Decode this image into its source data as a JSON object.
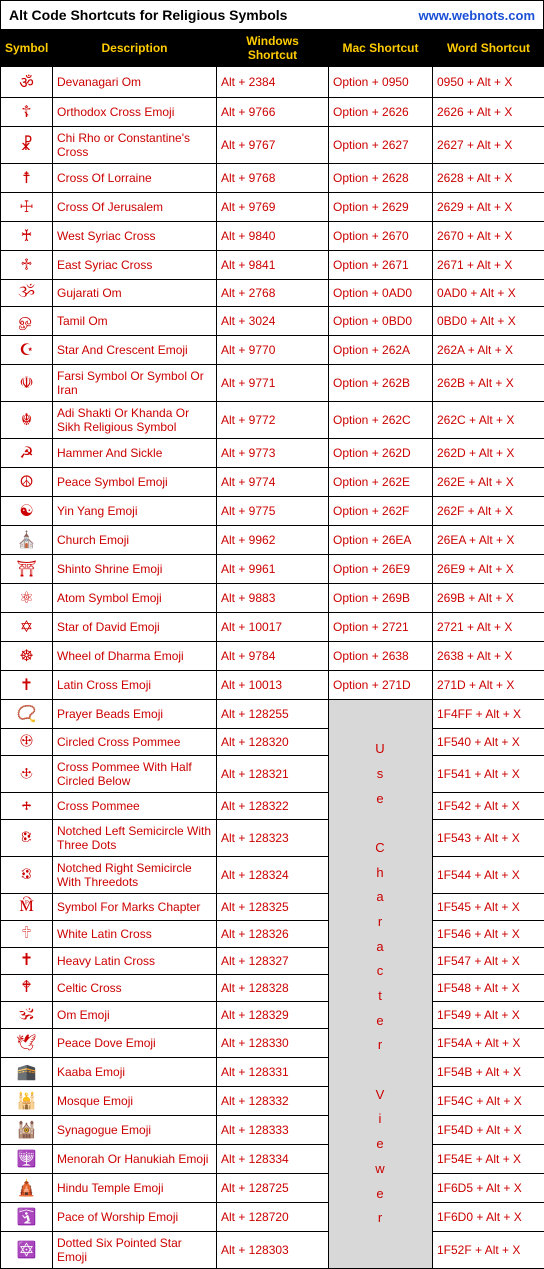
{
  "header": {
    "title": "Alt Code Shortcuts for Religious Symbols",
    "url": "www.webnots.com"
  },
  "columns": {
    "symbol": "Symbol",
    "description": "Description",
    "windows": "Windows Shortcut",
    "mac": "Mac Shortcut",
    "word": "Word Shortcut"
  },
  "mac_merged_text": "U\ns\ne\n\nC\nh\na\nr\na\nc\nt\ne\nr\n\nV\ni\ne\nw\ne\nr",
  "rows": [
    {
      "symbol": "ॐ",
      "description": "Devanagari Om",
      "windows": "Alt + 2384",
      "mac": "Option + 0950",
      "word": "0950 + Alt + X"
    },
    {
      "symbol": "☦",
      "description": "Orthodox Cross Emoji",
      "windows": "Alt + 9766",
      "mac": "Option + 2626",
      "word": "2626 + Alt + X"
    },
    {
      "symbol": "☧",
      "description": "Chi Rho or Constantine's Cross",
      "windows": "Alt + 9767",
      "mac": "Option + 2627",
      "word": "2627 + Alt + X"
    },
    {
      "symbol": "☨",
      "description": "Cross Of Lorraine",
      "windows": "Alt + 9768",
      "mac": "Option + 2628",
      "word": "2628 + Alt + X"
    },
    {
      "symbol": "☩",
      "description": "Cross Of Jerusalem",
      "windows": "Alt + 9769",
      "mac": "Option + 2629",
      "word": "2629 + Alt + X"
    },
    {
      "symbol": "♰",
      "description": "West Syriac Cross",
      "windows": "Alt + 9840",
      "mac": "Option + 2670",
      "word": "2670 + Alt + X"
    },
    {
      "symbol": "♱",
      "description": "East Syriac Cross",
      "windows": "Alt + 9841",
      "mac": "Option + 2671",
      "word": "2671 + Alt + X"
    },
    {
      "symbol": "ૐ",
      "description": "Gujarati Om",
      "windows": "Alt + 2768",
      "mac": "Option + 0AD0",
      "word": "0AD0 + Alt + X"
    },
    {
      "symbol": "ௐ",
      "description": "Tamil Om",
      "windows": "Alt + 3024",
      "mac": "Option + 0BD0",
      "word": "0BD0 + Alt + X"
    },
    {
      "symbol": "☪",
      "description": "Star And Crescent Emoji",
      "windows": "Alt + 9770",
      "mac": "Option + 262A",
      "word": "262A + Alt + X"
    },
    {
      "symbol": "☫",
      "description": "Farsi Symbol Or Symbol Or Iran",
      "windows": "Alt + 9771",
      "mac": "Option + 262B",
      "word": "262B + Alt + X"
    },
    {
      "symbol": "☬",
      "description": "Adi Shakti Or Khanda Or Sikh Religious Symbol",
      "windows": "Alt + 9772",
      "mac": "Option + 262C",
      "word": "262C + Alt + X"
    },
    {
      "symbol": "☭",
      "description": "Hammer And Sickle",
      "windows": "Alt + 9773",
      "mac": "Option + 262D",
      "word": "262D + Alt + X"
    },
    {
      "symbol": "☮",
      "description": "Peace Symbol Emoji",
      "windows": "Alt + 9774",
      "mac": "Option + 262E",
      "word": "262E + Alt + X"
    },
    {
      "symbol": "☯",
      "description": "Yin Yang Emoji",
      "windows": "Alt + 9775",
      "mac": "Option + 262F",
      "word": "262F + Alt + X"
    },
    {
      "symbol": "⛪",
      "description": "Church Emoji",
      "windows": "Alt + 9962",
      "mac": "Option + 26EA",
      "word": "26EA + Alt + X"
    },
    {
      "symbol": "⛩",
      "description": "Shinto Shrine Emoji",
      "windows": "Alt + 9961",
      "mac": "Option + 26E9",
      "word": "26E9 + Alt + X"
    },
    {
      "symbol": "⚛",
      "description": "Atom Symbol Emoji",
      "windows": "Alt + 9883",
      "mac": "Option + 269B",
      "word": "269B + Alt + X"
    },
    {
      "symbol": "✡",
      "description": "Star of David Emoji",
      "windows": "Alt + 10017",
      "mac": "Option + 2721",
      "word": "2721 + Alt + X"
    },
    {
      "symbol": "☸",
      "description": "Wheel of Dharma Emoji",
      "windows": "Alt + 9784",
      "mac": "Option + 2638",
      "word": "2638 + Alt + X"
    },
    {
      "symbol": "✝",
      "description": "Latin Cross Emoji",
      "windows": "Alt + 10013",
      "mac": "Option + 271D",
      "word": "271D + Alt + X"
    },
    {
      "symbol": "📿",
      "description": "Prayer Beads Emoji",
      "windows": "Alt + 128255",
      "mac": null,
      "word": "1F4FF + Alt + X"
    },
    {
      "symbol": "🕀",
      "description": "Circled Cross Pommee",
      "windows": "Alt + 128320",
      "mac": null,
      "word": "1F540 + Alt + X"
    },
    {
      "symbol": "🕁",
      "description": "Cross Pommee With Half Circled Below",
      "windows": "Alt + 128321",
      "mac": null,
      "word": "1F541 + Alt + X"
    },
    {
      "symbol": "🕂",
      "description": "Cross Pommee",
      "windows": "Alt + 128322",
      "mac": null,
      "word": "1F542 + Alt + X"
    },
    {
      "symbol": "🕃",
      "description": "Notched Left Semicircle With Three Dots",
      "windows": "Alt + 128323",
      "mac": null,
      "word": "1F543 + Alt + X"
    },
    {
      "symbol": "🕄",
      "description": "Notched Right Semicircle With Threedots",
      "windows": "Alt + 128324",
      "mac": null,
      "word": "1F544 + Alt + X"
    },
    {
      "symbol": "🕅",
      "description": "Symbol For Marks Chapter",
      "windows": "Alt + 128325",
      "mac": null,
      "word": "1F545 + Alt + X"
    },
    {
      "symbol": "🕆",
      "description": "White Latin Cross",
      "windows": "Alt + 128326",
      "mac": null,
      "word": "1F546 + Alt + X"
    },
    {
      "symbol": "🕇",
      "description": "Heavy Latin Cross",
      "windows": "Alt + 128327",
      "mac": null,
      "word": "1F547 + Alt + X"
    },
    {
      "symbol": "🕈",
      "description": "Celtic Cross",
      "windows": "Alt + 128328",
      "mac": null,
      "word": "1F548 + Alt + X"
    },
    {
      "symbol": "🕉",
      "description": "Om Emoji",
      "windows": "Alt + 128329",
      "mac": null,
      "word": "1F549 + Alt + X"
    },
    {
      "symbol": "🕊",
      "description": "Peace Dove Emoji",
      "windows": "Alt + 128330",
      "mac": null,
      "word": "1F54A + Alt + X"
    },
    {
      "symbol": "🕋",
      "description": "Kaaba Emoji",
      "windows": "Alt + 128331",
      "mac": null,
      "word": "1F54B + Alt + X"
    },
    {
      "symbol": "🕌",
      "description": "Mosque Emoji",
      "windows": "Alt + 128332",
      "mac": null,
      "word": "1F54C + Alt + X"
    },
    {
      "symbol": "🕍",
      "description": "Synagogue Emoji",
      "windows": "Alt + 128333",
      "mac": null,
      "word": "1F54D + Alt + X"
    },
    {
      "symbol": "🕎",
      "description": "Menorah Or Hanukiah Emoji",
      "windows": "Alt + 128334",
      "mac": null,
      "word": "1F54E + Alt + X"
    },
    {
      "symbol": "🛕",
      "description": "Hindu Temple Emoji",
      "windows": "Alt + 128725",
      "mac": null,
      "word": "1F6D5 + Alt + X"
    },
    {
      "symbol": "🛐",
      "description": "Pace of Worship Emoji",
      "windows": "Alt + 128720",
      "mac": null,
      "word": "1F6D0 + Alt + X"
    },
    {
      "symbol": "🔯",
      "description": "Dotted Six Pointed Star Emoji",
      "windows": "Alt + 128303",
      "mac": null,
      "word": "1F52F + Alt + X"
    }
  ]
}
